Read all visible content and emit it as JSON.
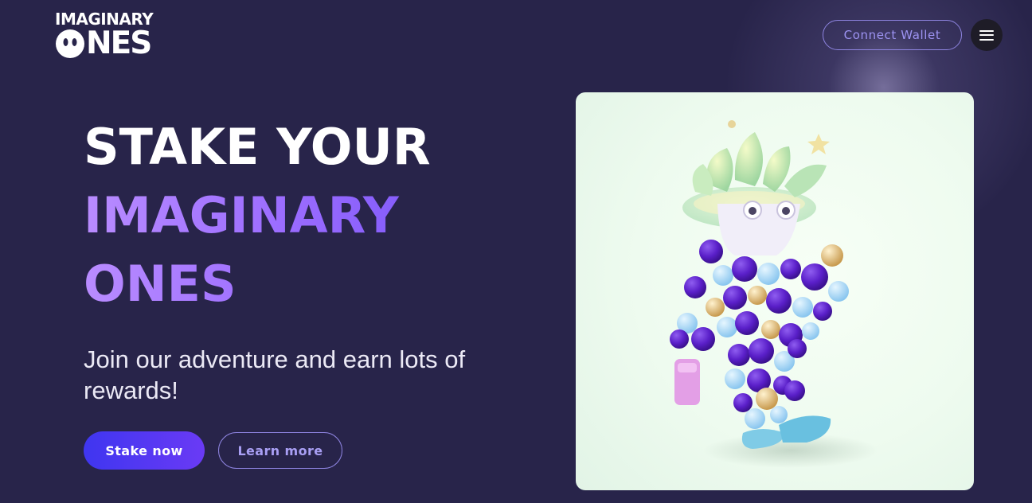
{
  "logo": {
    "line1": "IMAGINARY",
    "line2_rest": "NES",
    "brand_text": "IMAGINARY ONES"
  },
  "header": {
    "connect_wallet": "Connect Wallet",
    "menu_icon": "hamburger-icon"
  },
  "hero": {
    "title_line1": "STAKE YOUR",
    "title_line2": "IMAGINARY",
    "title_line3": "ONES",
    "subtitle": "Join our adventure and earn lots of rewards!",
    "primary_cta": "Stake now",
    "secondary_cta": "Learn more"
  },
  "colors": {
    "background": "#28244a",
    "accent_gradient_start": "#3f36f0",
    "accent_gradient_end": "#6a3af5",
    "title_gradient_start": "#b98cff",
    "title_gradient_end": "#6b4cf5",
    "outline_button": "#8e84e0",
    "card_background": "#eefbef"
  },
  "illustration": {
    "subject": "nft-character-illustration",
    "icon": "character-art"
  }
}
